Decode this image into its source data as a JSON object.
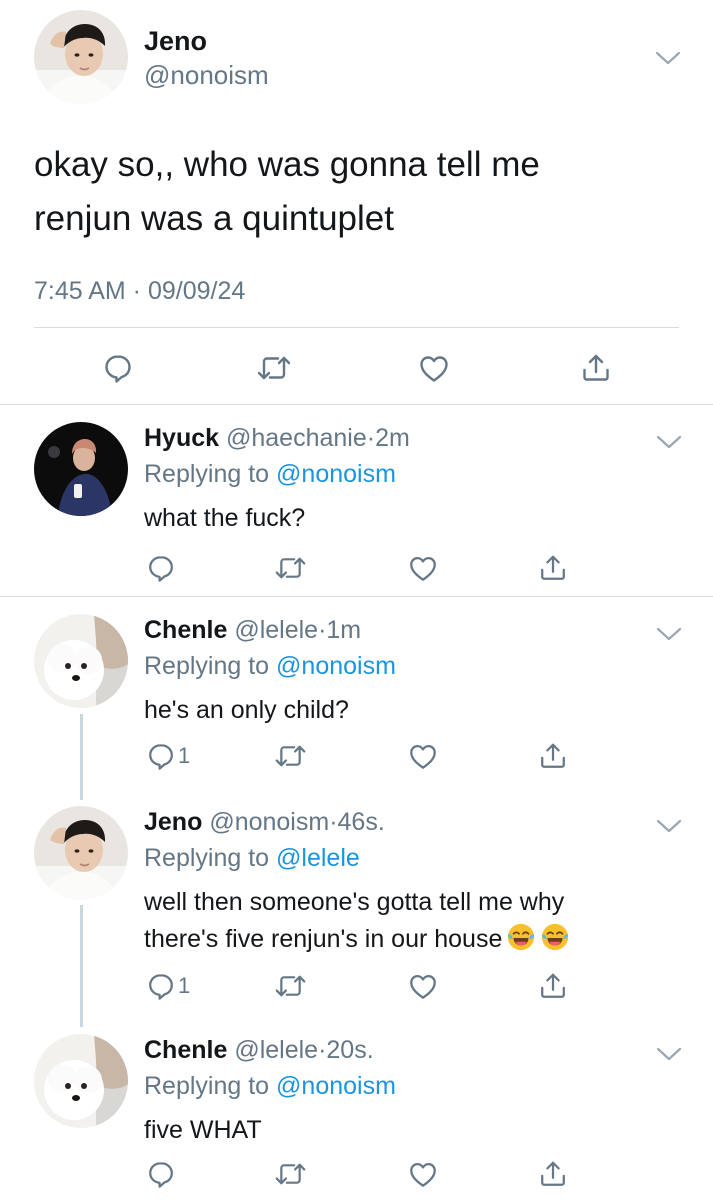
{
  "colors": {
    "text": "#14171a",
    "secondary": "#657786",
    "link": "#1b95e0",
    "divider": "#d8dde2",
    "thread_line": "#ccd6dd"
  },
  "main_tweet": {
    "name": "Jeno",
    "handle": "@nonoism",
    "text_line1": "okay so,, who was gonna tell me",
    "text_line2": "renjun was a quintuplet",
    "timestamp": "7:45 AM · 09/09/24",
    "icons": [
      "reply-icon",
      "retweet-icon",
      "like-icon",
      "share-icon"
    ]
  },
  "replies": [
    {
      "name": "Hyuck",
      "handle": "@haechanie",
      "dot": "·",
      "time": "2m",
      "replying_prefix": "Replying to ",
      "replying_to": "@nonoism",
      "text": "what the fuck?",
      "reply_count": ""
    },
    {
      "name": "Chenle",
      "handle": "@lelele",
      "dot": "·",
      "time": "1m",
      "replying_prefix": "Replying to ",
      "replying_to": "@nonoism",
      "text": "he's an only child?",
      "reply_count": "1"
    },
    {
      "name": "Jeno",
      "handle": "@nonoism",
      "dot": "·",
      "time": "46s.",
      "replying_prefix": "Replying to ",
      "replying_to": "@lelele",
      "text_line1": "well then someone's gotta tell me why",
      "text_line2": "there's five renjun's in our house",
      "emoji": [
        "face-with-tears-of-joy",
        "face-with-tears-of-joy"
      ],
      "reply_count": "1"
    },
    {
      "name": "Chenle",
      "handle": "@lelele",
      "dot": "·",
      "time": "20s.",
      "replying_prefix": "Replying to ",
      "replying_to": "@nonoism",
      "text": "five WHAT",
      "reply_count": ""
    }
  ]
}
